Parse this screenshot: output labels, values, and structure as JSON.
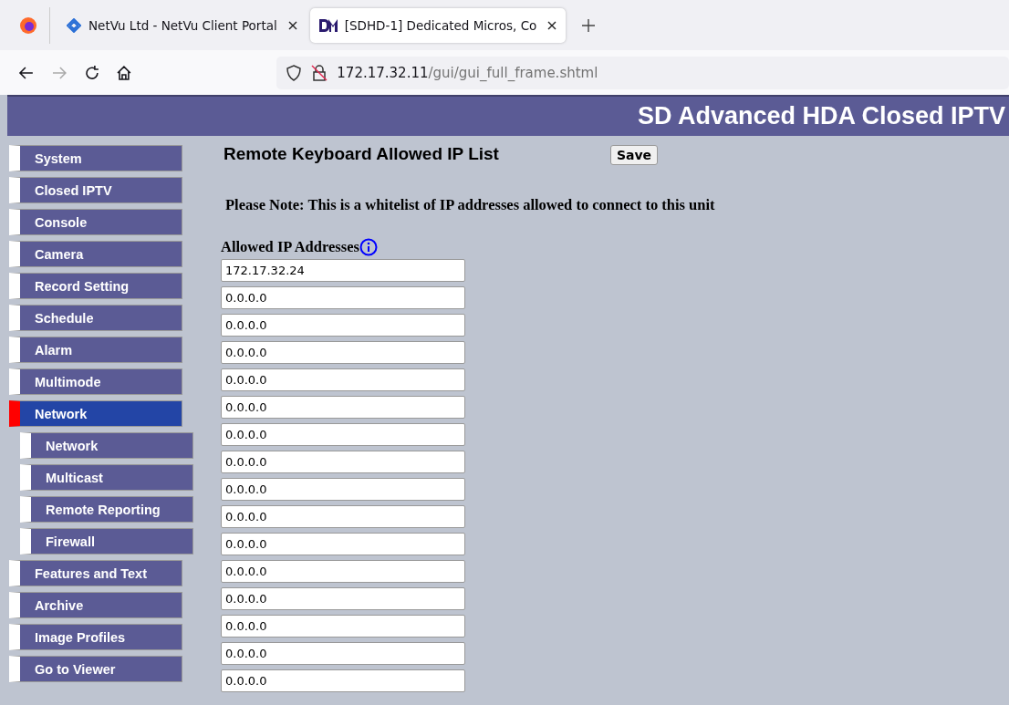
{
  "browser": {
    "tabs": [
      {
        "title": "NetVu Ltd - NetVu Client Portal",
        "selected": false,
        "kind": "netvu"
      },
      {
        "title": "[SDHD-1] Dedicated Micros, Co",
        "selected": true,
        "kind": "dm"
      }
    ],
    "address": {
      "host": "172.17.32.11",
      "path": "/gui/gui_full_frame.shtml"
    }
  },
  "header": {
    "title": "SD Advanced HDA Closed IPTV"
  },
  "sidebar": {
    "items": [
      {
        "label": "System",
        "selected": false
      },
      {
        "label": "Closed IPTV",
        "selected": false
      },
      {
        "label": "Console",
        "selected": false
      },
      {
        "label": "Camera",
        "selected": false
      },
      {
        "label": "Record Setting",
        "selected": false
      },
      {
        "label": "Schedule",
        "selected": false
      },
      {
        "label": "Alarm",
        "selected": false
      },
      {
        "label": "Multimode",
        "selected": false
      },
      {
        "label": "Network",
        "selected": true,
        "children": [
          {
            "label": "Network",
            "selected": false
          },
          {
            "label": "Multicast",
            "selected": false
          },
          {
            "label": "Remote Reporting",
            "selected": false
          },
          {
            "label": "Firewall",
            "selected": false
          }
        ]
      },
      {
        "label": "Features and Text",
        "selected": false
      },
      {
        "label": "Archive",
        "selected": false
      },
      {
        "label": "Image Profiles",
        "selected": false
      },
      {
        "label": "Go to Viewer",
        "selected": false
      }
    ]
  },
  "content": {
    "title": "Remote Keyboard Allowed IP List",
    "save_button": "Save",
    "note": "Please Note: This is a whitelist of IP addresses allowed to connect to this unit",
    "list_label": "Allowed IP Addresses",
    "addresses": [
      "172.17.32.24",
      "0.0.0.0",
      "0.0.0.0",
      "0.0.0.0",
      "0.0.0.0",
      "0.0.0.0",
      "0.0.0.0",
      "0.0.0.0",
      "0.0.0.0",
      "0.0.0.0",
      "0.0.0.0",
      "0.0.0.0",
      "0.0.0.0",
      "0.0.0.0",
      "0.0.0.0",
      "0.0.0.0"
    ]
  }
}
